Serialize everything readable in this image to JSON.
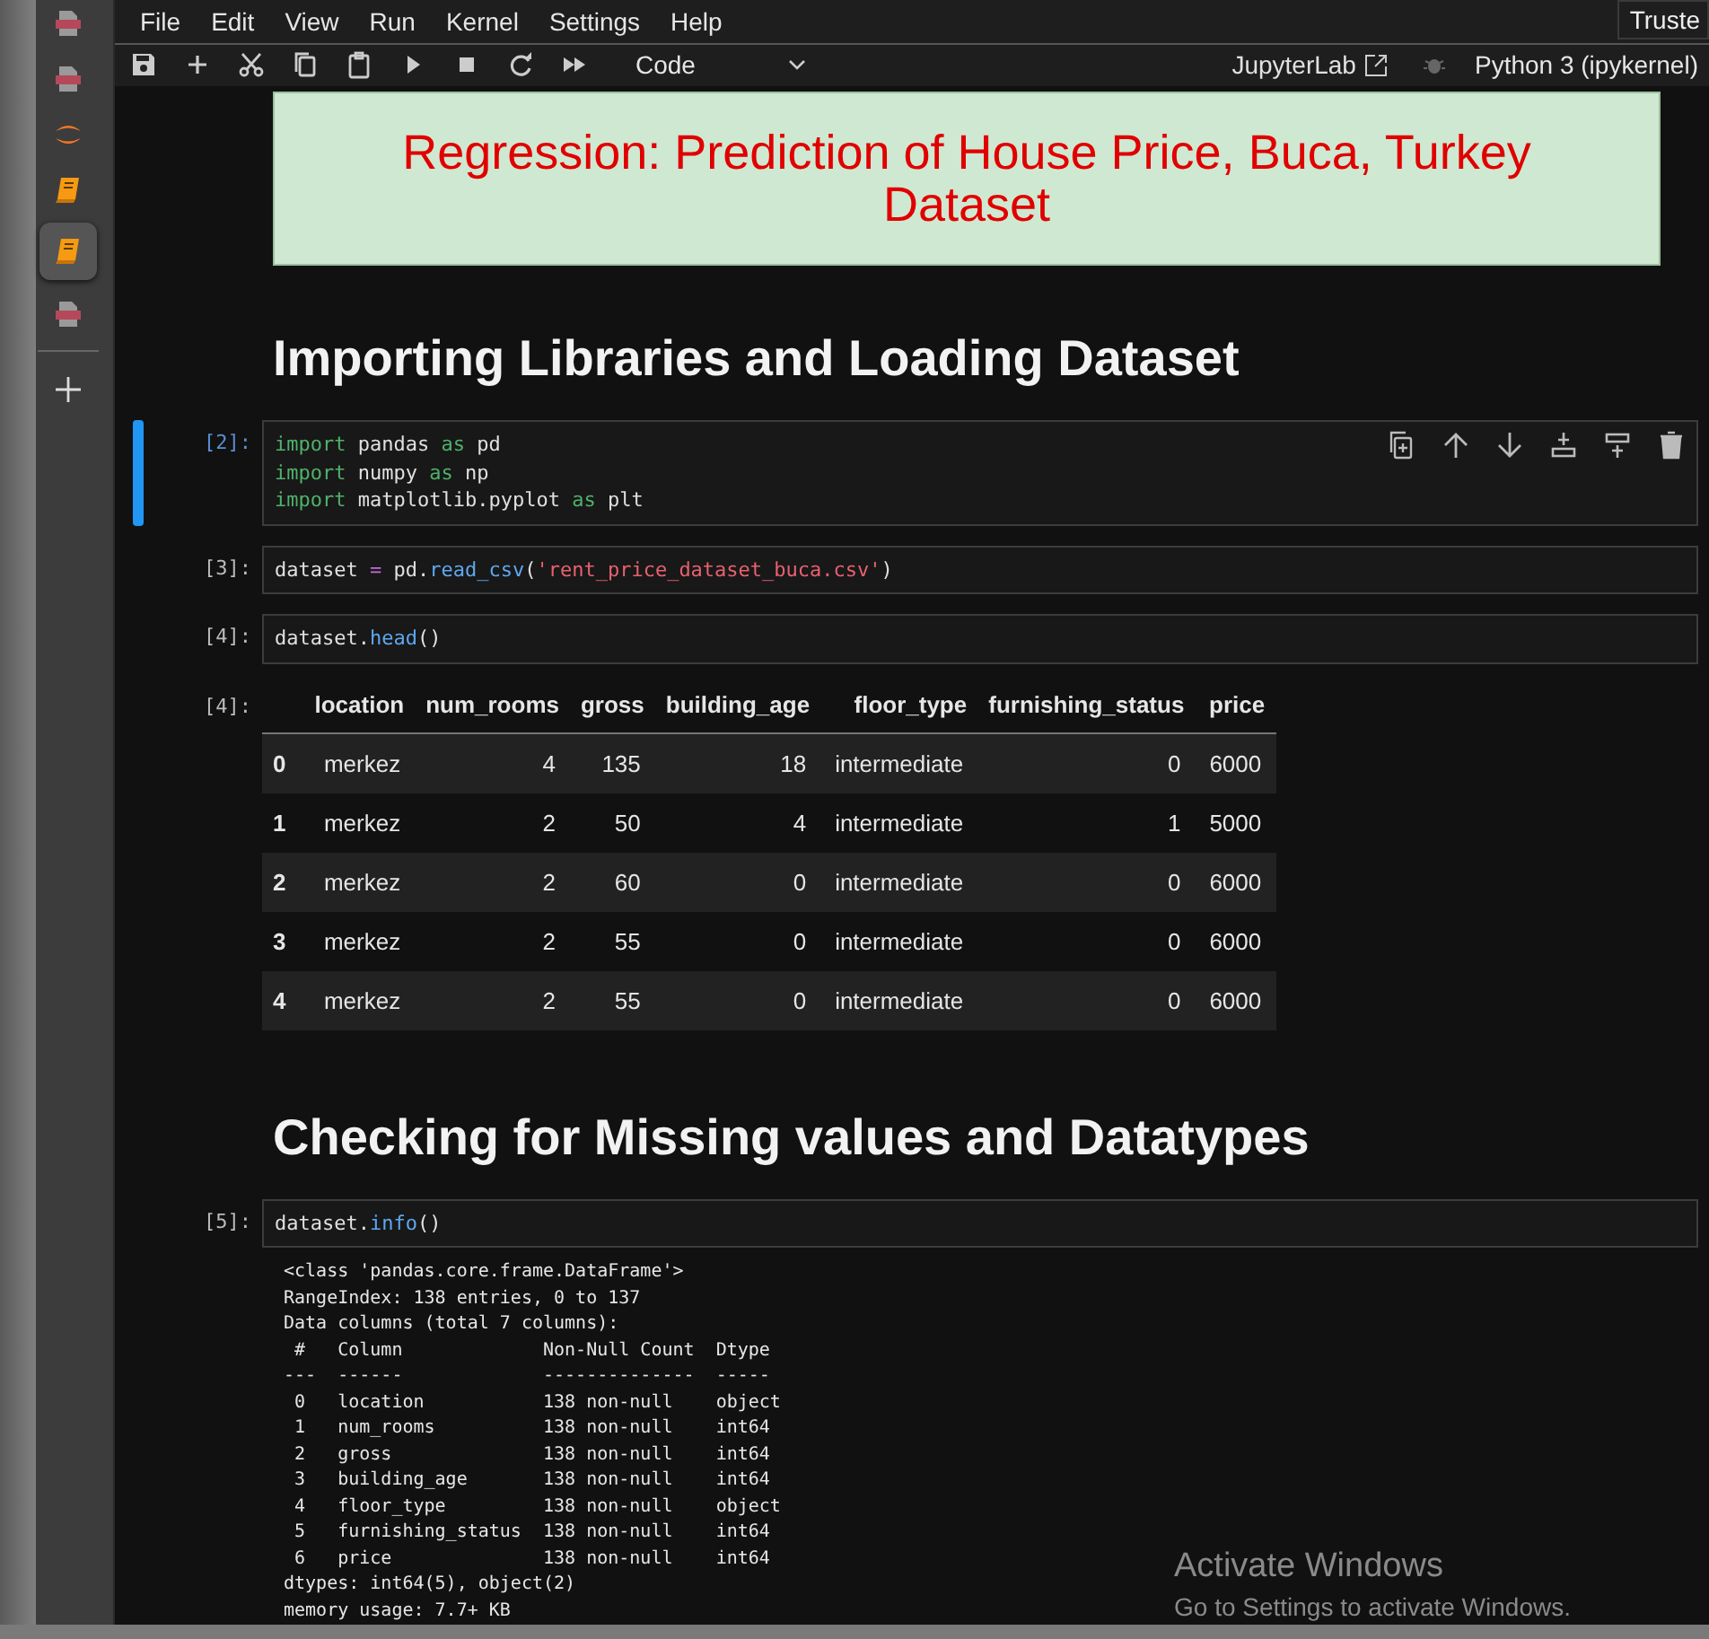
{
  "sidebar": {
    "items": [
      {
        "kind": "pdf",
        "selected": false
      },
      {
        "kind": "pdf",
        "selected": false
      },
      {
        "kind": "jupyter",
        "selected": false
      },
      {
        "kind": "notebook",
        "selected": false
      },
      {
        "kind": "notebook",
        "selected": true
      },
      {
        "kind": "pdf",
        "selected": false
      },
      {
        "kind": "add",
        "selected": false
      }
    ]
  },
  "menu": [
    "File",
    "Edit",
    "View",
    "Run",
    "Kernel",
    "Settings",
    "Help"
  ],
  "trusted_button": "Truste",
  "toolbar": {
    "cell_type": "Code",
    "app_link": "JupyterLab",
    "kernel": "Python 3 (ipykernel)"
  },
  "cells": [
    {
      "kind": "title",
      "text": "Regression: Prediction of House Price, Buca, Turkey Dataset"
    },
    {
      "kind": "heading",
      "text": "Importing Libraries and Loading Dataset"
    },
    {
      "kind": "code",
      "prompt": "[2]:",
      "active": true,
      "lines": [
        [
          {
            "kind": "kw",
            "text": "import"
          },
          {
            "kind": "name",
            "text": " pandas "
          },
          {
            "kind": "kw",
            "text": "as"
          },
          {
            "kind": "name",
            "text": " pd"
          }
        ],
        [
          {
            "kind": "kw",
            "text": "import"
          },
          {
            "kind": "name",
            "text": " numpy "
          },
          {
            "kind": "kw",
            "text": "as"
          },
          {
            "kind": "name",
            "text": " np"
          }
        ],
        [
          {
            "kind": "kw",
            "text": "import"
          },
          {
            "kind": "name",
            "text": " matplotlib.pyplot "
          },
          {
            "kind": "kw",
            "text": "as"
          },
          {
            "kind": "name",
            "text": " plt"
          }
        ]
      ]
    },
    {
      "kind": "code",
      "prompt": "[3]:",
      "active": false,
      "lines": [
        [
          {
            "kind": "name",
            "text": "dataset "
          },
          {
            "kind": "op",
            "text": "="
          },
          {
            "kind": "name",
            "text": " pd."
          },
          {
            "kind": "func",
            "text": "read_csv"
          },
          {
            "kind": "name",
            "text": "("
          },
          {
            "kind": "str",
            "text": "'rent_price_dataset_buca.csv'"
          },
          {
            "kind": "name",
            "text": ")"
          }
        ]
      ]
    },
    {
      "kind": "code",
      "prompt": "[4]:",
      "active": false,
      "lines": [
        [
          {
            "kind": "name",
            "text": "dataset."
          },
          {
            "kind": "func",
            "text": "head"
          },
          {
            "kind": "name",
            "text": "()"
          }
        ]
      ]
    },
    {
      "kind": "table",
      "prompt": "[4]:",
      "columns": [
        "location",
        "num_rooms",
        "gross",
        "building_age",
        "floor_type",
        "furnishing_status",
        "price"
      ],
      "rows": [
        {
          "index": "0",
          "cells": [
            "merkez",
            "4",
            "135",
            "18",
            "intermediate",
            "0",
            "6000"
          ]
        },
        {
          "index": "1",
          "cells": [
            "merkez",
            "2",
            "50",
            "4",
            "intermediate",
            "1",
            "5000"
          ]
        },
        {
          "index": "2",
          "cells": [
            "merkez",
            "2",
            "60",
            "0",
            "intermediate",
            "0",
            "6000"
          ]
        },
        {
          "index": "3",
          "cells": [
            "merkez",
            "2",
            "55",
            "0",
            "intermediate",
            "0",
            "6000"
          ]
        },
        {
          "index": "4",
          "cells": [
            "merkez",
            "2",
            "55",
            "0",
            "intermediate",
            "0",
            "6000"
          ]
        }
      ]
    },
    {
      "kind": "heading",
      "text": "Checking for Missing values and Datatypes"
    },
    {
      "kind": "code",
      "prompt": "[5]:",
      "active": false,
      "lines": [
        [
          {
            "kind": "name",
            "text": "dataset."
          },
          {
            "kind": "func",
            "text": "info"
          },
          {
            "kind": "name",
            "text": "()"
          }
        ]
      ]
    },
    {
      "kind": "stream",
      "lines": [
        "<class 'pandas.core.frame.DataFrame'>",
        "RangeIndex: 138 entries, 0 to 137",
        "Data columns (total 7 columns):",
        " #   Column             Non-Null Count  Dtype ",
        "---  ------             --------------  ----- ",
        " 0   location           138 non-null    object",
        " 1   num_rooms          138 non-null    int64 ",
        " 2   gross              138 non-null    int64 ",
        " 3   building_age       138 non-null    int64 ",
        " 4   floor_type         138 non-null    object",
        " 5   furnishing_status  138 non-null    int64 ",
        " 6   price              138 non-null    int64 ",
        "dtypes: int64(5), object(2)",
        "memory usage: 7.7+ KB"
      ]
    }
  ],
  "os_notice": {
    "title": "Activate Windows",
    "text": "Go to Settings to activate Windows."
  }
}
